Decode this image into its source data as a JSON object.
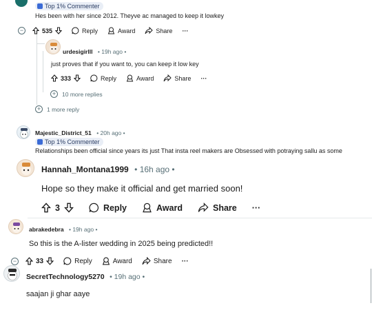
{
  "top_comment": {
    "badge": "Top 1% Commenter",
    "text": "Hes been with her since 2012. Theyve ac managed to keep it lowkey",
    "score": "535",
    "reply": "Reply",
    "award": "Award",
    "share": "Share",
    "more": "···"
  },
  "reply1": {
    "username": "urdesigirlll",
    "meta": "• 19h ago •",
    "text": "just proves that if you want to, you can keep it low key",
    "score": "333",
    "reply": "Reply",
    "award": "Award",
    "share": "Share",
    "more": "···",
    "more_replies": "10 more replies"
  },
  "one_more_reply": "1 more reply",
  "comment2": {
    "username": "Majestic_District_51",
    "meta": "• 20h ago •",
    "badge": "Top 1% Commenter",
    "text": "Relationships been official since years its just That insta reel makers are Obsessed with potraying sallu as some"
  },
  "comment3": {
    "username": "Hannah_Montana1999",
    "meta": "• 16h ago •",
    "text": "Hope so they make it official and get married soon!",
    "score": "3",
    "reply": "Reply",
    "award": "Award",
    "share": "Share",
    "more": "···"
  },
  "comment4": {
    "username": "abrakedebra",
    "meta": "• 19h ago •",
    "text": "So this is the A-lister wedding in 2025 being predicted!!",
    "score": "33",
    "reply": "Reply",
    "award": "Award",
    "share": "Share",
    "more": "···"
  },
  "comment5": {
    "username": "SecretTechnology5270",
    "meta": "• 19h ago •",
    "text": "saajan ji ghar aaye"
  }
}
